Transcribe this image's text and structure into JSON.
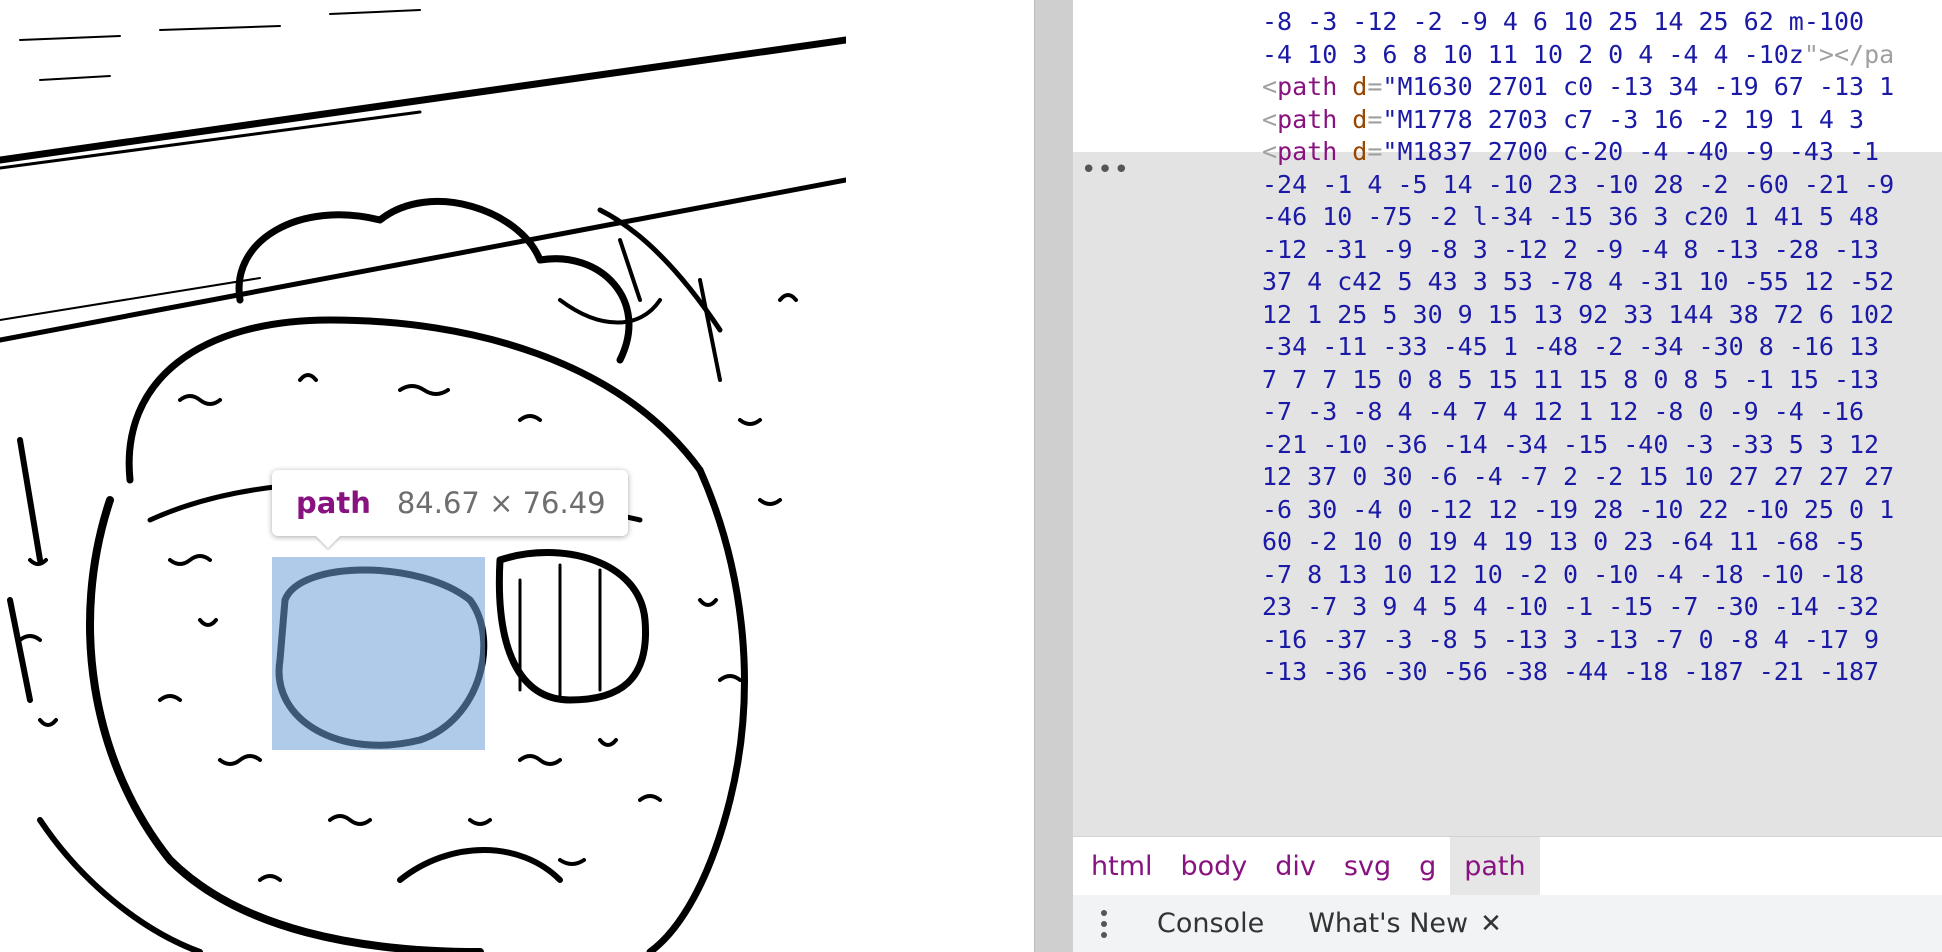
{
  "tooltip": {
    "tag": "path",
    "dimensions": "84.67 × 76.49"
  },
  "code_lines": [
    {
      "pre": "",
      "tag": "",
      "attr": "",
      "value": "-8 -3 -12 -2 -9 4 6 10 25 14 25 62 m-100 ",
      "post": ""
    },
    {
      "pre": "",
      "tag": "",
      "attr": "",
      "value": "-4 10 3 6 8 10 11 10 2 0 4 -4 4 -10z",
      "post": "\"></pa"
    },
    {
      "pre": "<",
      "tag": "path",
      "attr": "d",
      "value": "\"M1630 2701 c0 -13 34 -19 67 -13 1",
      "post": ""
    },
    {
      "pre": "<",
      "tag": "path",
      "attr": "d",
      "value": "\"M1778 2703 c7 -3 16 -2 19 1 4 3 ",
      "post": ""
    },
    {
      "pre": "<",
      "tag": "path",
      "attr": "d",
      "value": "\"M1837 2700 c-20 -4 -40 -9 -43 -1",
      "post": ""
    },
    {
      "pre": "",
      "tag": "",
      "attr": "",
      "value": "-24 -1 4 -5 14 -10 23 -10 28 -2 -60 -21 -9",
      "post": ""
    },
    {
      "pre": "",
      "tag": "",
      "attr": "",
      "value": "-46 10 -75 -2 l-34 -15 36 3 c20 1 41 5 48",
      "post": ""
    },
    {
      "pre": "",
      "tag": "",
      "attr": "",
      "value": "-12 -31 -9 -8 3 -12 2 -9 -4 8 -13 -28 -13",
      "post": ""
    },
    {
      "pre": "",
      "tag": "",
      "attr": "",
      "value": "37 4 c42 5 43 3 53 -78 4 -31 10 -55 12 -52",
      "post": ""
    },
    {
      "pre": "",
      "tag": "",
      "attr": "",
      "value": "12 1 25 5 30 9 15 13 92 33 144 38 72 6 102",
      "post": ""
    },
    {
      "pre": "",
      "tag": "",
      "attr": "",
      "value": "-34 -11 -33 -45 1 -48 -2 -34 -30 8 -16 13",
      "post": ""
    },
    {
      "pre": "",
      "tag": "",
      "attr": "",
      "value": "7 7 7 15 0 8 5 15 11 15 8 0 8 5 -1 15 -13",
      "post": ""
    },
    {
      "pre": "",
      "tag": "",
      "attr": "",
      "value": "-7 -3 -8 4 -4 7 4 12 1 12 -8 0 -9 -4 -16 ",
      "post": ""
    },
    {
      "pre": "",
      "tag": "",
      "attr": "",
      "value": "-21 -10 -36 -14 -34 -15 -40 -3 -33 5 3 12",
      "post": ""
    },
    {
      "pre": "",
      "tag": "",
      "attr": "",
      "value": "12 37 0 30 -6 -4 -7 2 -2 15 10 27 27 27 27",
      "post": ""
    },
    {
      "pre": "",
      "tag": "",
      "attr": "",
      "value": "-6 30 -4 0 -12 12 -19 28 -10 22 -10 25 0 1",
      "post": ""
    },
    {
      "pre": "",
      "tag": "",
      "attr": "",
      "value": "60 -2 10 0 19 4 19 13 0 23 -64 11 -68 -5 ",
      "post": ""
    },
    {
      "pre": "",
      "tag": "",
      "attr": "",
      "value": "-7 8 13 10 12 10 -2 0 -10 -4 -18 -10 -18 ",
      "post": ""
    },
    {
      "pre": "",
      "tag": "",
      "attr": "",
      "value": "23 -7 3 9 4 5 4 -10 -1 -15 -7 -30 -14 -32 ",
      "post": ""
    },
    {
      "pre": "",
      "tag": "",
      "attr": "",
      "value": "-16 -37 -3 -8 5 -13 3 -13 -7 0 -8 4 -17 9",
      "post": ""
    },
    {
      "pre": "",
      "tag": "",
      "attr": "",
      "value": "-13 -36 -30 -56 -38 -44 -18 -187 -21 -187",
      "post": ""
    }
  ],
  "ellipsis": "•••",
  "breadcrumbs": [
    "html",
    "body",
    "div",
    "svg",
    "g",
    "path"
  ],
  "drawer": {
    "tabs": [
      {
        "label": "Console",
        "closable": false
      },
      {
        "label": "What's New",
        "closable": true
      }
    ],
    "close_glyph": "✕"
  },
  "colors": {
    "highlight": "#6fa1d8",
    "tag": "#881280",
    "attr": "#994500",
    "value": "#1a1aa6",
    "selected_row": "#e3e3e3"
  }
}
